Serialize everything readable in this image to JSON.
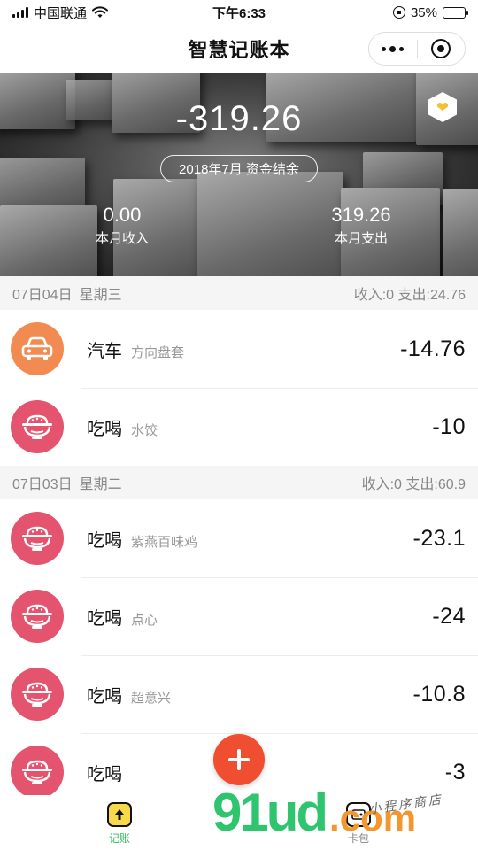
{
  "status_bar": {
    "carrier": "中国联通",
    "time": "下午6:33",
    "battery": "35%",
    "battery_level": 0.35
  },
  "nav": {
    "title": "智慧记账本"
  },
  "summary": {
    "balance": "-319.26",
    "month_label": "2018年7月 资金结余",
    "income_value": "0.00",
    "income_label": "本月收入",
    "expense_value": "319.26",
    "expense_label": "本月支出"
  },
  "days": [
    {
      "date": "07日04日",
      "weekday": "星期三",
      "summary": "收入:0 支出:24.76",
      "records": [
        {
          "category": "汽车",
          "note": "方向盘套",
          "amount": "-14.76",
          "icon": "car-icon",
          "color": "#f28b51"
        },
        {
          "category": "吃喝",
          "note": "水饺",
          "amount": "-10",
          "icon": "bowl-icon",
          "color": "#e5546e"
        }
      ]
    },
    {
      "date": "07日03日",
      "weekday": "星期二",
      "summary": "收入:0 支出:60.9",
      "records": [
        {
          "category": "吃喝",
          "note": "紫燕百味鸡",
          "amount": "-23.1",
          "icon": "bowl-icon",
          "color": "#e5546e"
        },
        {
          "category": "吃喝",
          "note": "点心",
          "amount": "-24",
          "icon": "bowl-icon",
          "color": "#e5546e"
        },
        {
          "category": "吃喝",
          "note": "超意兴",
          "amount": "-10.8",
          "icon": "bowl-icon",
          "color": "#e5546e"
        },
        {
          "category": "吃喝",
          "note": "",
          "amount": "-3",
          "icon": "bowl-icon",
          "color": "#e5546e"
        }
      ]
    }
  ],
  "tabs": {
    "record_label": "记账",
    "wallet_label": "卡包"
  },
  "watermark": {
    "main": "91ud",
    "suffix": ".com",
    "sub": "小程序商店"
  },
  "colors": {
    "fab": "#ef4e31",
    "tab_active": "#2fbd5e",
    "car": "#f28b51",
    "food": "#e5546e"
  }
}
